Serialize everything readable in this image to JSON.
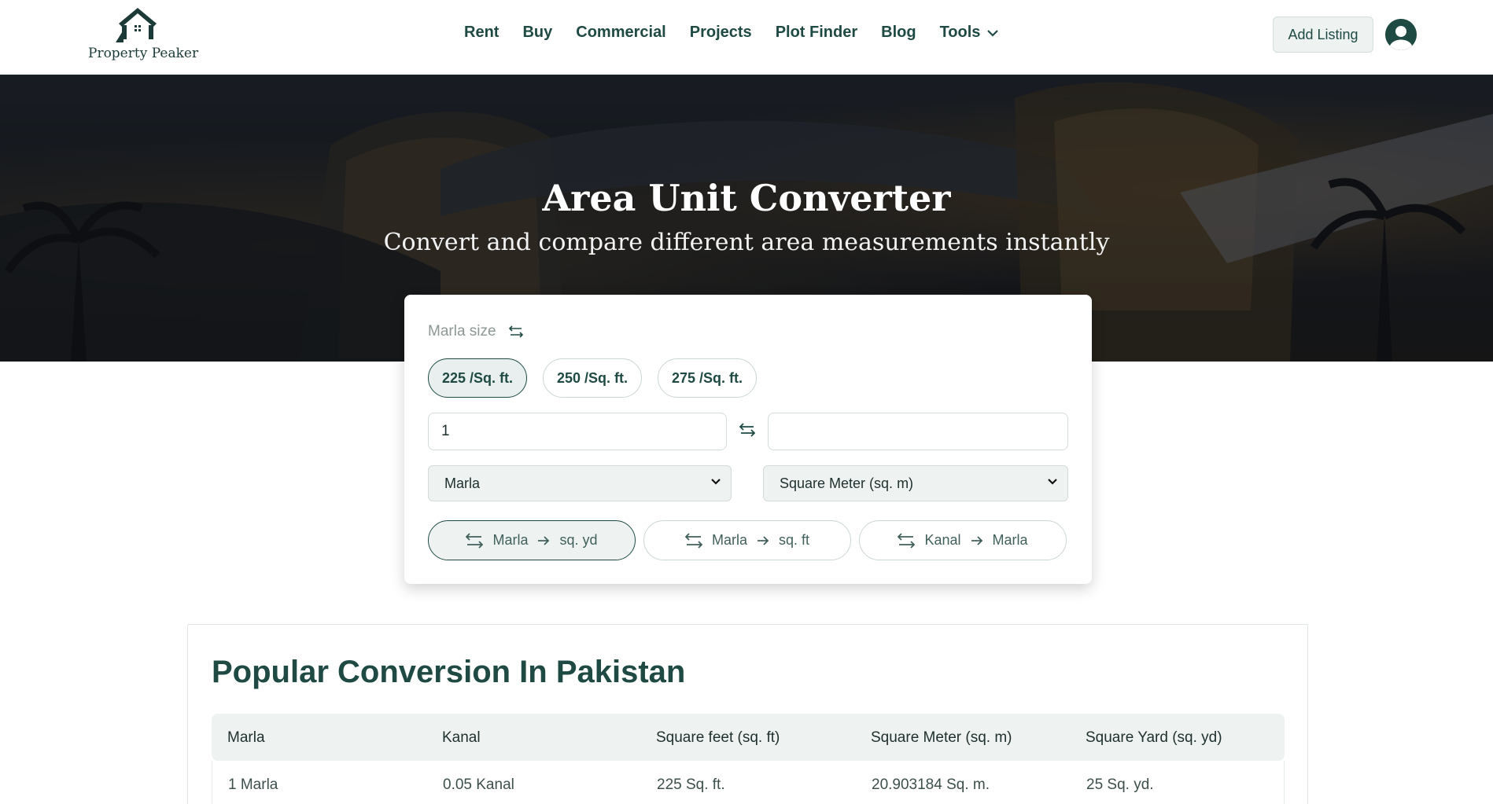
{
  "brand": {
    "name": "Property Peaker"
  },
  "nav": {
    "items": [
      "Rent",
      "Buy",
      "Commercial",
      "Projects",
      "Plot Finder",
      "Blog",
      "Tools"
    ]
  },
  "header": {
    "add_listing": "Add Listing"
  },
  "hero": {
    "title": "Area Unit Converter",
    "subtitle": "Convert and compare different area measurements instantly"
  },
  "converter": {
    "marla_size_label": "Marla size",
    "marla_options": [
      "225 /Sq. ft.",
      "250 /Sq. ft.",
      "275 /Sq. ft."
    ],
    "selected_marla_option": "225 /Sq. ft.",
    "from_value": "1",
    "to_value": "",
    "from_unit": "Marla",
    "to_unit": "Square Meter (sq. m)",
    "quick_conversions": [
      {
        "from": "Marla",
        "to": "sq. yd"
      },
      {
        "from": "Marla",
        "to": "sq. ft"
      },
      {
        "from": "Kanal",
        "to": "Marla"
      }
    ]
  },
  "popular": {
    "title": "Popular Conversion In Pakistan",
    "columns": [
      "Marla",
      "Kanal",
      "Square feet (sq. ft)",
      "Square Meter (sq. m)",
      "Square Yard (sq. yd)"
    ],
    "rows": [
      [
        "1 Marla",
        "0.05 Kanal",
        "225 Sq. ft.",
        "20.903184 Sq. m.",
        "25 Sq. yd."
      ]
    ]
  },
  "colors": {
    "brand": "#1f4a44",
    "hero_bg": "#1b1e23"
  },
  "icons": [
    "house-logo-icon",
    "chevron-down-icon",
    "user-avatar-icon",
    "swap-icon",
    "arrow-right-icon",
    "select-arrow-icon"
  ]
}
